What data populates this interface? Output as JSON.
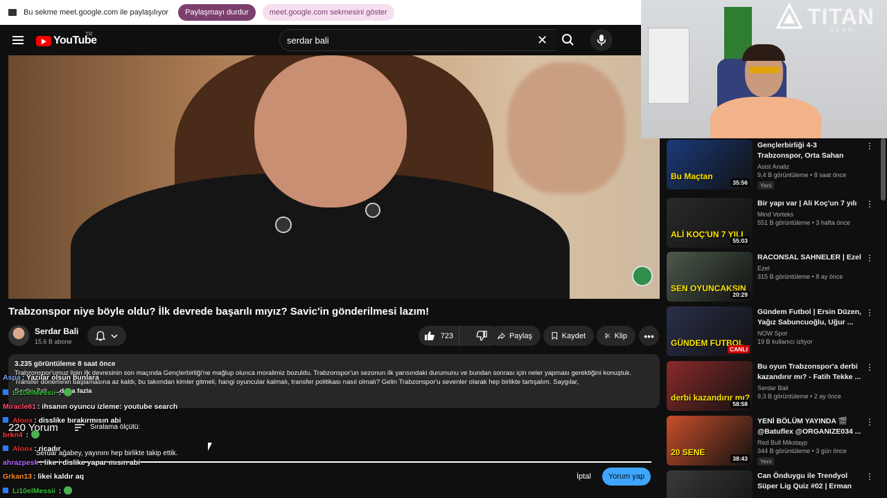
{
  "sharebar": {
    "text": "Bu sekme meet.google.com ile paylaşılıyor",
    "stop_label": "Paylaşmayı durdur",
    "show_label": "meet.google.com sekmesini göster"
  },
  "header": {
    "logo_text": "YouTube",
    "country": "TR",
    "search_value": "serdar bali"
  },
  "video": {
    "title": "Trabzonspor niye böyle oldu? İlk devrede başarılı mıyız? Savic'in gönderilmesi lazım!"
  },
  "channel": {
    "name": "Serdar Bali",
    "subs": "15,6 B abone"
  },
  "actions": {
    "likes": "723",
    "share": "Paylaş",
    "save": "Kaydet",
    "clip": "Klip",
    "more": "•••"
  },
  "description": {
    "meta": "3.235 görüntüleme  8 saat önce",
    "line1": "Trabzonspor'umuz ligin ilk devresinin son maçında Gençlerbirliği'ne mağlup olunca moralimiz bozuldu. Trabzonspor'un sezonun ilk yarısındaki durumunu ve bundan sonrası için neler yapması gerektiğini konuştuk. Transfer döneminin başlamasına az kaldı, bu takımdan kimler gitmeli, hangi oyuncular kalmalı, transfer politikası nasıl olmalı? Gelin Trabzonspor'u sevenler olarak hep birlikte tartışalım. Saygılar,",
    "line2": "Serdar Bali...",
    "more": "...daha fazla"
  },
  "comments": {
    "count": "220 Yorum",
    "sort": "Sıralama ölçütü:",
    "input_value": "Serdar ağabey, yayınını hep birlikte takip ettik.",
    "cancel": "İptal",
    "submit": "Yorum yap"
  },
  "chat": [
    {
      "user": "Aspa",
      "msg": ": Yazılar olsun bunlara",
      "color": "#7aa7ff"
    },
    {
      "user": "Li10elMessii",
      "msg": " :",
      "color": "#3fbf3f",
      "emote": true,
      "mod": true
    },
    {
      "user": "Miracle61",
      "msg": ": ihsanın oyuncu izleme: youtube search",
      "color": "#ff4d6d"
    },
    {
      "user": "Aloox",
      "msg": ": disslike bırakırmısın abi",
      "color": "#e03030",
      "mod": true
    },
    {
      "user": "brkn4",
      "msg": " :",
      "color": "#ff3b3b",
      "emote": true
    },
    {
      "user": "Aloox",
      "msg": ": ricadır",
      "color": "#e03030",
      "mod": true
    },
    {
      "user": "ahrazpesk",
      "msg": ": like i dislike yapar mısın abi",
      "color": "#b16bff"
    },
    {
      "user": "Grkan13",
      "msg": ": likei kaldır aq",
      "color": "#ff8c2a"
    },
    {
      "user": "Li10elMessii",
      "msg": " :",
      "color": "#3fbf3f",
      "emote": true,
      "mod": true
    }
  ],
  "overlay": {
    "brand": "TITAN",
    "brand_sub": "GEAR"
  },
  "recommendations": [
    {
      "title": "Gençlerbirliği 4-3 Trabzonspor, Orta Sahan Kadar Takımsın, Arif...",
      "channel": "Asist Analiz",
      "stats": "9,4 B görüntüleme • 8 saat önce",
      "duration": "35:56",
      "thumb_text": "Bu Maçtan",
      "new": "Yeni",
      "thumb_color": "#1b3a7a"
    },
    {
      "title": "Bir yapı var | Ali Koç'un 7 yılı",
      "channel": "Mind Vorteks",
      "stats": "551 B görüntüleme • 3 hafta önce",
      "duration": "55:03",
      "thumb_text": "ALİ KOÇ'UN 7 YILI",
      "new": "",
      "thumb_color": "#2a2a2a"
    },
    {
      "title": "RACONSAL SAHNELER | Ezel",
      "channel": "Ezel",
      "stats": "315 B görüntüleme • 8 ay önce",
      "duration": "20:29",
      "thumb_text": "SEN OYUNCAKSIN",
      "new": "",
      "thumb_color": "#4b5a4b"
    },
    {
      "title": "Gündem Futbol | Ersin Düzen, Yağız Sabuncuoğlu, Uğur ...",
      "channel": "NOW Spor",
      "stats": "19 B kullanıcı izliyor",
      "duration": "CANLI",
      "thumb_text": "GÜNDEM FUTBOL",
      "new": "",
      "thumb_color": "#2a2f4a"
    },
    {
      "title": "Bu oyun Trabzonspor'a derbi kazandırır mı? - Fatih Tekke ...",
      "channel": "Serdar Bali",
      "stats": "9,3 B görüntüleme • 2 ay önce",
      "duration": "58:58",
      "thumb_text": "derbi kazandırır mı?",
      "new": "",
      "thumb_color": "#8a2a2a"
    },
    {
      "title": "YENİ BÖLÜM YAYINDA 🎬 @Batuflex @ORGANIZE034 ...",
      "channel": "Red Bull Mikstayp",
      "stats": "344 B görüntüleme • 3 gün önce",
      "duration": "38:43",
      "thumb_text": "20 SENE",
      "new": "Yeni",
      "thumb_color": "#c94f2a"
    },
    {
      "title": "Can Önduygu ile Trendyol Süper Lig Quiz #02 | Erman Yaşar",
      "channel": "",
      "stats": "",
      "duration": "",
      "thumb_text": "20 SENE ÖNÜNDEYMİŞ",
      "new": "",
      "thumb_color": "#3a3a3a"
    }
  ]
}
